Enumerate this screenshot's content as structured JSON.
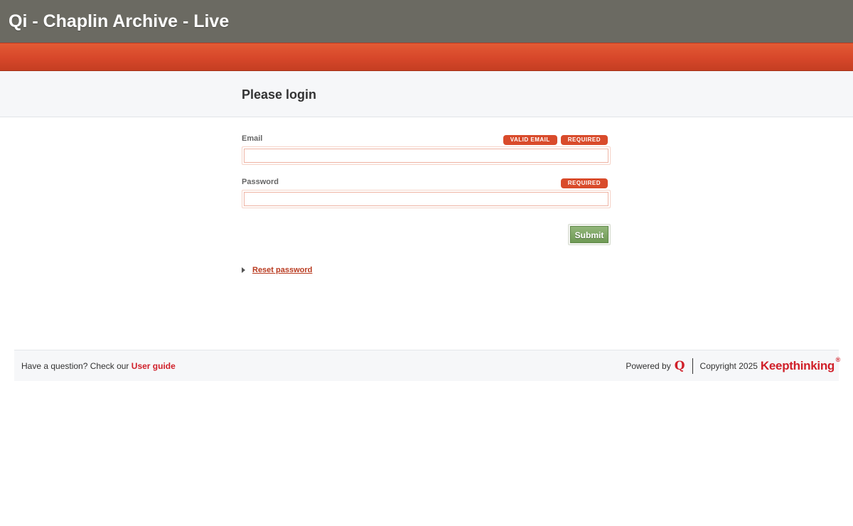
{
  "header": {
    "title": "Qi - Chaplin Archive - Live"
  },
  "page": {
    "heading": "Please login"
  },
  "form": {
    "email": {
      "label": "Email",
      "badges": [
        "VALID EMAIL",
        "REQUIRED"
      ],
      "value": ""
    },
    "password": {
      "label": "Password",
      "badges": [
        "REQUIRED"
      ],
      "value": ""
    },
    "submit_label": "Submit",
    "reset_label": "Reset password"
  },
  "footer": {
    "question_text": "Have a question? Check our",
    "guide_link": "User guide",
    "powered_by": "Powered by",
    "qi_logo": "Q",
    "copyright": "Copyright 2025",
    "brand": "Keepthinking",
    "brand_mark": "®"
  },
  "colors": {
    "topbar": "#6b6a62",
    "accent": "#d7472a",
    "badge": "#d94b2b",
    "submit": "#7ea463",
    "link": "#b8391e",
    "brand": "#d0202a"
  }
}
